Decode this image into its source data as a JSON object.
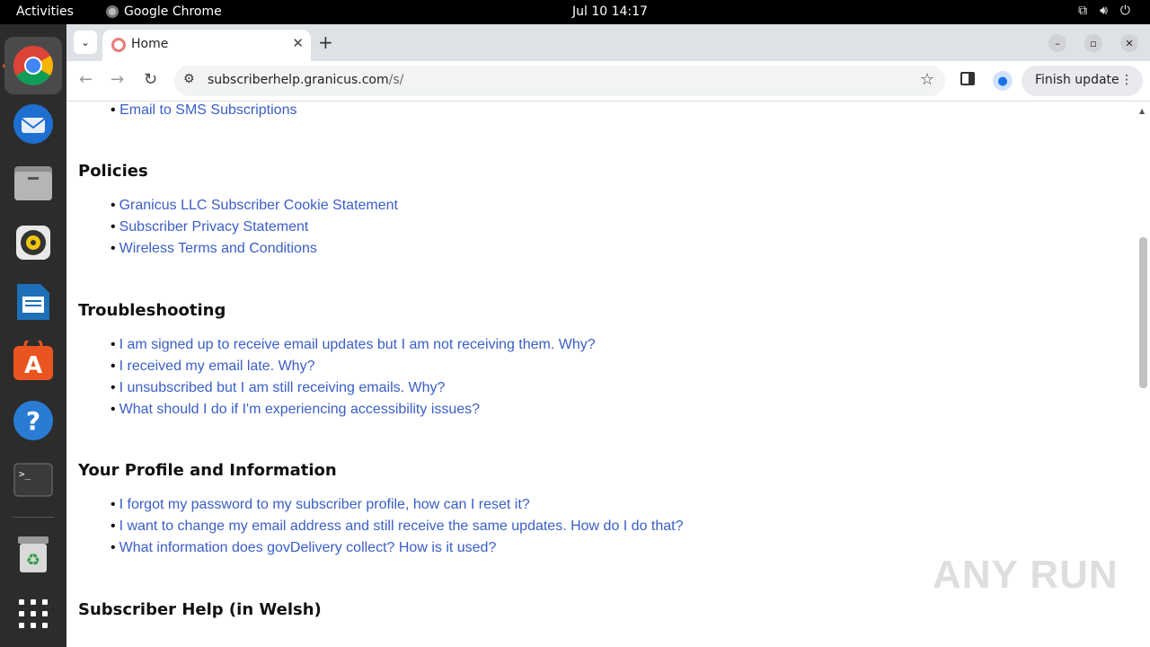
{
  "topbar": {
    "activities": "Activities",
    "app_name": "Google Chrome",
    "clock": "Jul 10  14:17"
  },
  "dock": {
    "items": [
      "chrome-icon",
      "thunderbird-icon",
      "files-icon",
      "rhythmbox-icon",
      "writer-icon",
      "app-center-icon",
      "help-icon",
      "terminal-icon",
      "trash-icon",
      "app-grid-icon"
    ]
  },
  "browser": {
    "tab_title": "Home",
    "url_host": "subscriberhelp.granicus.com",
    "url_path": "/s/",
    "finish_update": "Finish update"
  },
  "content": {
    "top_item": "Email to SMS Subscriptions",
    "sections": [
      {
        "heading": "Policies",
        "items": [
          "Granicus LLC Subscriber Cookie Statement",
          "Subscriber Privacy Statement",
          "Wireless Terms and Conditions"
        ]
      },
      {
        "heading": "Troubleshooting",
        "items": [
          "I am signed up to receive email updates but I am not receiving them. Why?",
          "I received my email late. Why?",
          "I unsubscribed but I am still receiving emails. Why?",
          "What should I do if I'm experiencing accessibility issues?"
        ]
      },
      {
        "heading": "Your Profile and Information",
        "items": [
          "I forgot my password to my subscriber profile, how can I reset it?",
          "I want to change my email address and still receive the same updates. How do I do that?",
          "What information does govDelivery collect? How is it used?"
        ]
      },
      {
        "heading": "Subscriber Help (in Welsh)",
        "items": []
      }
    ]
  },
  "watermark": "ANY RUN"
}
